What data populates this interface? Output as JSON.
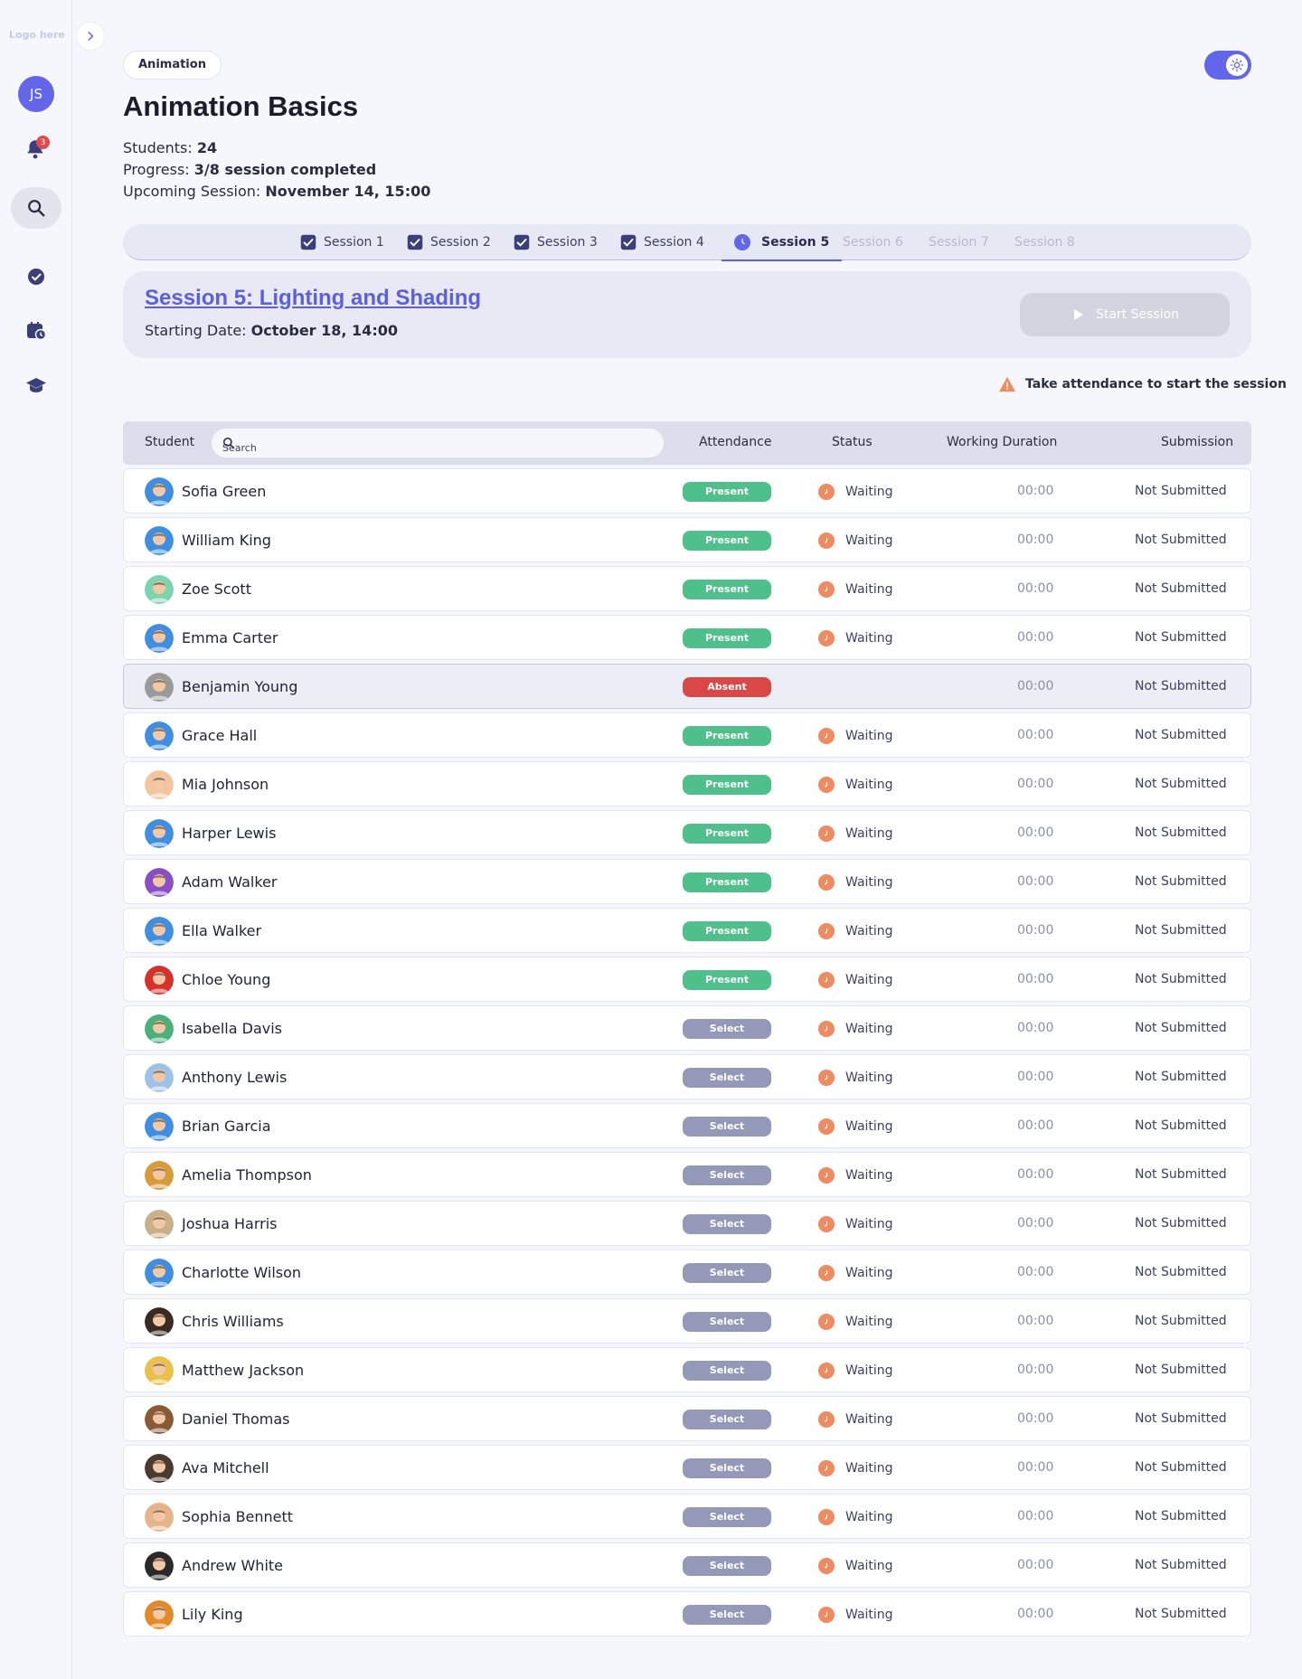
{
  "sidebar": {
    "logo": "Logo here",
    "user_initials": "JS",
    "notification_count": "3"
  },
  "header": {
    "tag": "Animation",
    "title": "Animation Basics",
    "students_label": "Students:",
    "students_value": "24",
    "progress_label": "Progress:",
    "progress_value": "3/8 session completed",
    "upcoming_label": "Upcoming Session:",
    "upcoming_value": "November 14, 15:00"
  },
  "tabs": [
    {
      "label": "Session 1",
      "state": "done"
    },
    {
      "label": "Session 2",
      "state": "done"
    },
    {
      "label": "Session 3",
      "state": "done"
    },
    {
      "label": "Session 4",
      "state": "done"
    },
    {
      "label": "Session 5",
      "state": "active"
    },
    {
      "label": "Session 6",
      "state": "disabled"
    },
    {
      "label": "Session 7",
      "state": "disabled"
    },
    {
      "label": "Session 8",
      "state": "disabled"
    }
  ],
  "session": {
    "title": "Session 5: Lighting and Shading",
    "date_label": "Starting Date:",
    "date_value": "October 18, 14:00",
    "start_label": "Start Session",
    "warning": "Take attendance to start the session"
  },
  "table": {
    "headers": {
      "student": "Student",
      "search_placeholder": "Search",
      "attendance": "Attendance",
      "status": "Status",
      "duration": "Working Duration",
      "submission": "Submission"
    },
    "rows": [
      {
        "name": "Sofia Green",
        "attendance": "Present",
        "status": "Waiting",
        "duration": "00:00",
        "submission": "Not Submitted",
        "color": "#3f8ee0"
      },
      {
        "name": "William King",
        "attendance": "Present",
        "status": "Waiting",
        "duration": "00:00",
        "submission": "Not Submitted",
        "color": "#3f8ee0"
      },
      {
        "name": "Zoe Scott",
        "attendance": "Present",
        "status": "Waiting",
        "duration": "00:00",
        "submission": "Not Submitted",
        "color": "#7ed3b0"
      },
      {
        "name": "Emma Carter",
        "attendance": "Present",
        "status": "Waiting",
        "duration": "00:00",
        "submission": "Not Submitted",
        "color": "#3f8ee0"
      },
      {
        "name": "Benjamin Young",
        "attendance": "Absent",
        "status": "",
        "duration": "00:00",
        "submission": "Not Submitted",
        "color": "#9a9a9a"
      },
      {
        "name": "Grace Hall",
        "attendance": "Present",
        "status": "Waiting",
        "duration": "00:00",
        "submission": "Not Submitted",
        "color": "#3f8ee0"
      },
      {
        "name": "Mia Johnson",
        "attendance": "Present",
        "status": "Waiting",
        "duration": "00:00",
        "submission": "Not Submitted",
        "color": "#f3c6a0"
      },
      {
        "name": "Harper Lewis",
        "attendance": "Present",
        "status": "Waiting",
        "duration": "00:00",
        "submission": "Not Submitted",
        "color": "#3f8ee0"
      },
      {
        "name": "Adam Walker",
        "attendance": "Present",
        "status": "Waiting",
        "duration": "00:00",
        "submission": "Not Submitted",
        "color": "#8a4fc4"
      },
      {
        "name": "Ella Walker",
        "attendance": "Present",
        "status": "Waiting",
        "duration": "00:00",
        "submission": "Not Submitted",
        "color": "#3f8ee0"
      },
      {
        "name": "Chloe Young",
        "attendance": "Present",
        "status": "Waiting",
        "duration": "00:00",
        "submission": "Not Submitted",
        "color": "#d8302a"
      },
      {
        "name": "Isabella Davis",
        "attendance": "Select",
        "status": "Waiting",
        "duration": "00:00",
        "submission": "Not Submitted",
        "color": "#4cb07a"
      },
      {
        "name": "Anthony Lewis",
        "attendance": "Select",
        "status": "Waiting",
        "duration": "00:00",
        "submission": "Not Submitted",
        "color": "#9ec1e8"
      },
      {
        "name": "Brian Garcia",
        "attendance": "Select",
        "status": "Waiting",
        "duration": "00:00",
        "submission": "Not Submitted",
        "color": "#3f8ee0"
      },
      {
        "name": "Amelia Thompson",
        "attendance": "Select",
        "status": "Waiting",
        "duration": "00:00",
        "submission": "Not Submitted",
        "color": "#d99a3a"
      },
      {
        "name": "Joshua Harris",
        "attendance": "Select",
        "status": "Waiting",
        "duration": "00:00",
        "submission": "Not Submitted",
        "color": "#c9b08a"
      },
      {
        "name": "Charlotte Wilson",
        "attendance": "Select",
        "status": "Waiting",
        "duration": "00:00",
        "submission": "Not Submitted",
        "color": "#3f8ee0"
      },
      {
        "name": "Chris Williams",
        "attendance": "Select",
        "status": "Waiting",
        "duration": "00:00",
        "submission": "Not Submitted",
        "color": "#3a2a22"
      },
      {
        "name": "Matthew Jackson",
        "attendance": "Select",
        "status": "Waiting",
        "duration": "00:00",
        "submission": "Not Submitted",
        "color": "#e8c04a"
      },
      {
        "name": "Daniel Thomas",
        "attendance": "Select",
        "status": "Waiting",
        "duration": "00:00",
        "submission": "Not Submitted",
        "color": "#8a5a34"
      },
      {
        "name": "Ava Mitchell",
        "attendance": "Select",
        "status": "Waiting",
        "duration": "00:00",
        "submission": "Not Submitted",
        "color": "#4a3a30"
      },
      {
        "name": "Sophia Bennett",
        "attendance": "Select",
        "status": "Waiting",
        "duration": "00:00",
        "submission": "Not Submitted",
        "color": "#e7b38a"
      },
      {
        "name": "Andrew White",
        "attendance": "Select",
        "status": "Waiting",
        "duration": "00:00",
        "submission": "Not Submitted",
        "color": "#2a2a2a"
      },
      {
        "name": "Lily King",
        "attendance": "Select",
        "status": "Waiting",
        "duration": "00:00",
        "submission": "Not Submitted",
        "color": "#e28a2a"
      }
    ]
  }
}
